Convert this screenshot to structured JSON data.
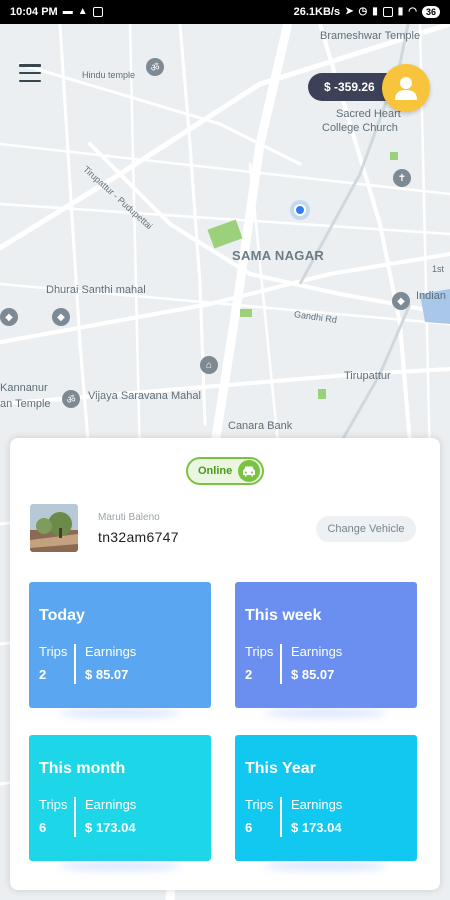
{
  "status_bar": {
    "time": "10:04 PM",
    "speed": "26.1KB/s",
    "battery": "36"
  },
  "map": {
    "labels": {
      "brameshwar_temple": "Brameshwar Temple",
      "hindu_temple": "Hindu temple",
      "sacred_heart": "Sacred Heart",
      "college_church": "College Church",
      "tirupattur_road": "Tirupattur - Pudupettai",
      "sama_nagar": "SAMA NAGAR",
      "dhurai_santhi": "Dhurai Santhi mahal",
      "indian": "Indian",
      "gandhi_rd": "Gandhi Rd",
      "kannanur": "Kannanur",
      "an_temple": "an Temple",
      "vijaya_saravana": "Vijaya Saravana Mahal",
      "tirupattur": "Tirupattur",
      "canara_bank": "Canara Bank",
      "ist": "1st"
    }
  },
  "header": {
    "balance": "$ -359.26"
  },
  "panel": {
    "status_label": "Online",
    "vehicle_model": "Maruti Baleno",
    "vehicle_plate": "tn32am6747",
    "change_vehicle_label": "Change Vehicle",
    "cards": {
      "today": {
        "title": "Today",
        "trips_label": "Trips",
        "trips": "2",
        "earnings_label": "Earnings",
        "earnings": "$ 85.07"
      },
      "week": {
        "title": "This week",
        "trips_label": "Trips",
        "trips": "2",
        "earnings_label": "Earnings",
        "earnings": "$ 85.07"
      },
      "month": {
        "title": "This month",
        "trips_label": "Trips",
        "trips": "6",
        "earnings_label": "Earnings",
        "earnings": "$ 173.04"
      },
      "year": {
        "title": "This Year",
        "trips_label": "Trips",
        "trips": "6",
        "earnings_label": "Earnings",
        "earnings": "$ 173.04"
      }
    }
  },
  "colors": {
    "accent_online": "#7cc242",
    "avatar_bg": "#f8c43c",
    "balance_bg": "#3d4157",
    "card_today": "#5aa6f0",
    "card_week": "#6b8ff0",
    "card_month": "#1dd6e8",
    "card_year": "#11c8f0"
  },
  "icons": [
    "hamburger-menu-icon",
    "user-icon",
    "car-icon",
    "location-dot-icon",
    "map-pin-icon"
  ]
}
